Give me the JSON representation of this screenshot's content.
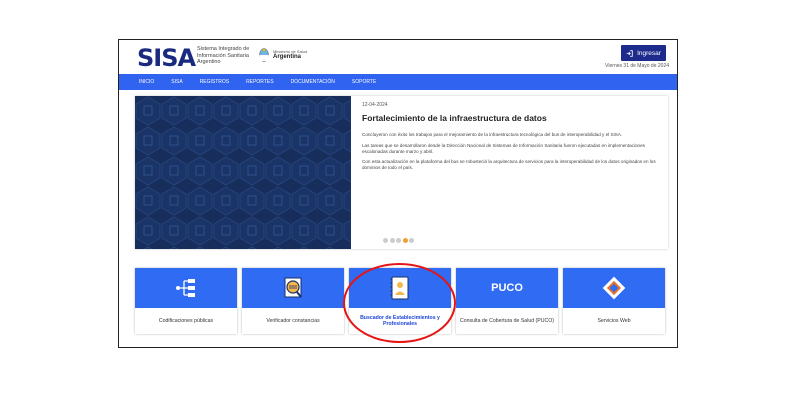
{
  "header": {
    "logo_text": "SISA",
    "logo_subtitle": "Sistema Integrado de Información Sanitaria Argentino",
    "ministry_small": "Ministerio de Salud",
    "ministry_big": "Argentina",
    "login_label": "Ingresar",
    "date": "Viernes 31 de Mayo de 2024"
  },
  "nav": {
    "items": [
      {
        "label": "INICIO"
      },
      {
        "label": "SISA"
      },
      {
        "label": "REGISTROS"
      },
      {
        "label": "REPORTES"
      },
      {
        "label": "DOCUMENTACIÓN"
      },
      {
        "label": "SOPORTE"
      }
    ]
  },
  "hero": {
    "date": "12-04-2024",
    "title": "Fortalecimiento de la infraestructura de datos",
    "paragraphs": [
      "Concluyeron con éxito los trabajos para el mejoramiento de la infraestructura tecnológica del bus de interoperabilidad y el SISA.",
      "Las tareas que se desarrollaron desde la Dirección Nacional de Sistemas de Información Sanitaria fueron ejecutadas en implementaciones escalonadas durante marzo y abril.",
      "Con esta actualización en la plataforma del bus se robusteció la arquitectura de servicios para la interoperabilidad de los datos originados en los dominios de todo el país."
    ],
    "carousel_active_index": 3,
    "carousel_count": 5
  },
  "cards": [
    {
      "label": "Codificaciones públicas",
      "icon": "hierarchy-icon"
    },
    {
      "label": "Verificador constancias",
      "icon": "magnifier-certificate-icon"
    },
    {
      "label": "Buscador de Establecimientos y Profesionales",
      "icon": "book-doctor-icon"
    },
    {
      "label": "Consulta de Cobertura de Salud (PUCO)",
      "icon_text": "PUCO"
    },
    {
      "label": "Servicios Web",
      "icon": "puzzle-icon"
    }
  ],
  "colors": {
    "nav_blue": "#2f63f0",
    "login_blue": "#1d2b8c",
    "highlight_red": "#e61414",
    "carousel_active": "#f0a030"
  }
}
